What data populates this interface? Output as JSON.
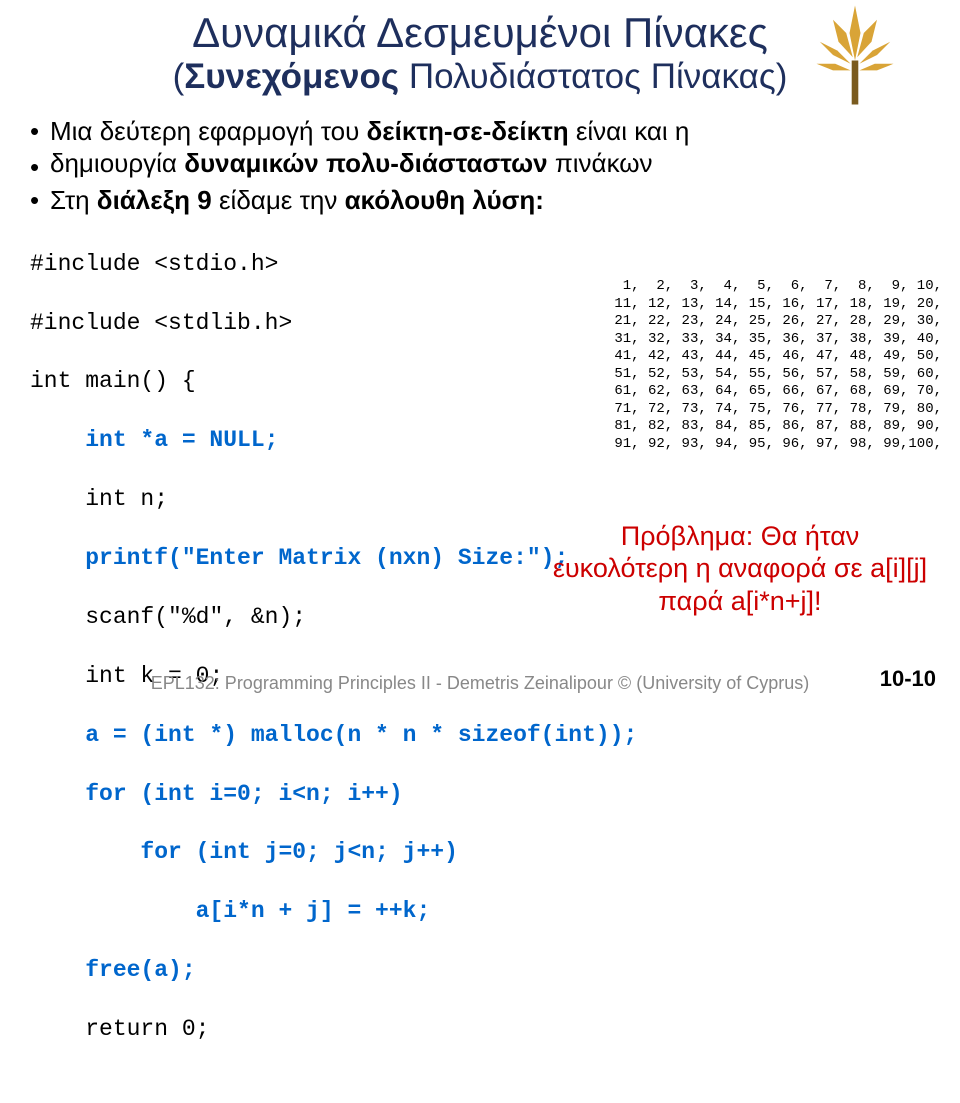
{
  "logo": {
    "name": "leaf-tree-logo"
  },
  "title": "Δυναμικά Δεσμευμένοι Πίνακες",
  "subtitle_open": "(",
  "subtitle_bold": "Συνεχόμενος",
  "subtitle_rest": " Πολυδιάστατος Πίνακας)",
  "bullet1_a": "Μια δεύτερη εφαρμογή του ",
  "bullet1_b": "δείκτη-σε-δείκτη",
  "bullet1_c": " είναι και η",
  "bullet1_line2_a": "δημιουργία ",
  "bullet1_line2_b": "δυναμικών πολυ-διάσταστων",
  "bullet1_line2_c": " πινάκων",
  "bullet2_a": "Στη ",
  "bullet2_b": "διάλεξη 9 ",
  "bullet2_c": "είδαμε την ",
  "bullet2_d": "ακόλουθη λύση:",
  "code": {
    "l1": "#include <stdio.h>",
    "l2": "#include <stdlib.h>",
    "l3": "int main() {",
    "l4": "    int *a = NULL;",
    "l5a": "    ",
    "l5b": "int n;",
    "l6": "    printf(\"Enter Matrix (nxn) Size:\");",
    "l7a": "    ",
    "l7b": "scanf(\"%d\", &n);",
    "l8a": "    ",
    "l8b": "int k = 0;",
    "l9": "    a = (int *) malloc(n * n * sizeof(int));",
    "l10": "    for (int i=0; i<n; i++)",
    "l11": "        for (int j=0; j<n; j++)",
    "l12": "            a[i*n + j] = ++k;",
    "l13": "    free(a);",
    "l14a": "    ",
    "l14b": "return 0;"
  },
  "matrix": " 1,  2,  3,  4,  5,  6,  7,  8,  9, 10,\n11, 12, 13, 14, 15, 16, 17, 18, 19, 20,\n21, 22, 23, 24, 25, 26, 27, 28, 29, 30,\n31, 32, 33, 34, 35, 36, 37, 38, 39, 40,\n41, 42, 43, 44, 45, 46, 47, 48, 49, 50,\n51, 52, 53, 54, 55, 56, 57, 58, 59, 60,\n61, 62, 63, 64, 65, 66, 67, 68, 69, 70,\n71, 72, 73, 74, 75, 76, 77, 78, 79, 80,\n81, 82, 83, 84, 85, 86, 87, 88, 89, 90,\n91, 92, 93, 94, 95, 96, 97, 98, 99,100,",
  "problem": "Πρόβλημα: Θα ήταν ευκολότερη η αναφορά σε a[i][j] παρά a[i*n+j]!",
  "footer": "EPL132: Programming Principles II - Demetris Zeinalipour © (University of Cyprus)",
  "slideno": "10-10"
}
